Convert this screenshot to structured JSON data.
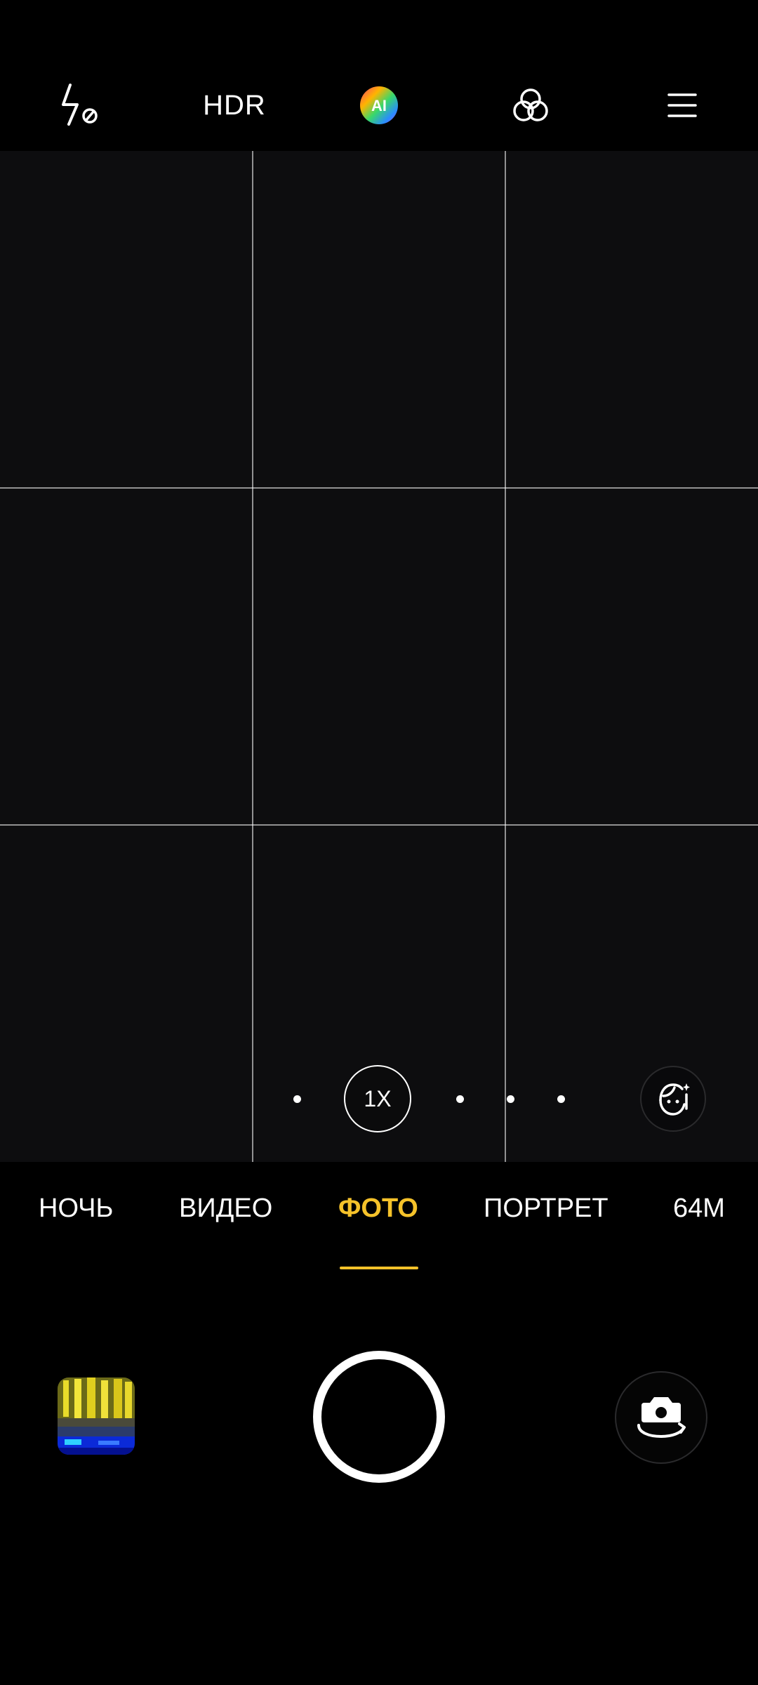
{
  "top_bar": {
    "flash_icon": "flash-off-icon",
    "hdr_label": "HDR",
    "ai_label": "AI",
    "filter_icon": "filters-icon",
    "menu_icon": "menu-icon"
  },
  "viewfinder": {
    "grid": "3x3",
    "zoom_label": "1X",
    "beauty_icon": "face-beauty-icon"
  },
  "modes": {
    "items": [
      "НОЧЬ",
      "ВИДЕО",
      "ФОТО",
      "ПОРТРЕТ",
      "64M"
    ],
    "active": "ФОТО"
  },
  "bottom": {
    "gallery_icon": "gallery-thumbnail",
    "shutter_icon": "shutter-button",
    "switch_icon": "switch-camera-icon"
  },
  "colors": {
    "accent": "#f5c22a",
    "background": "#000000",
    "viewfinder": "#0d0d0f"
  }
}
